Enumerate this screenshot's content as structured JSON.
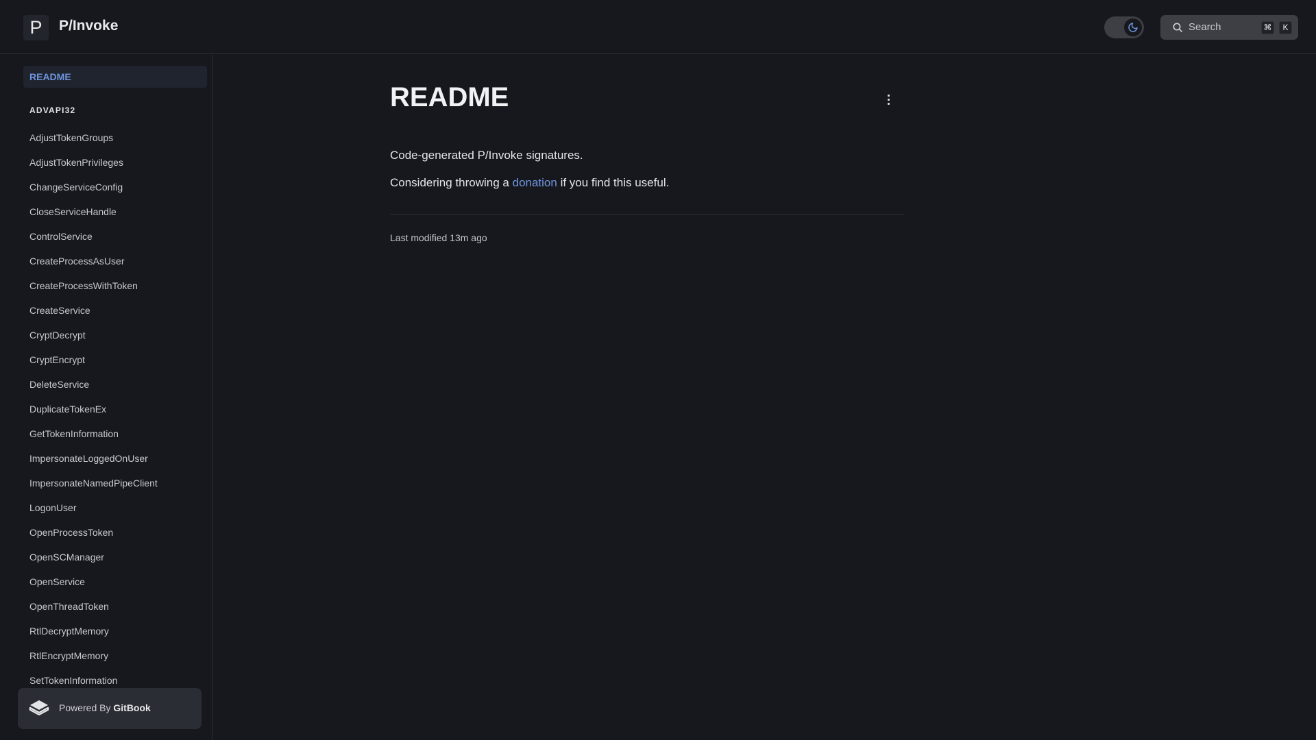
{
  "header": {
    "logo_letter": "P",
    "site_title": "P/Invoke",
    "theme_toggle_icon": "moon-icon",
    "search": {
      "label": "Search",
      "shortcut_keys": [
        "⌘",
        "K"
      ]
    }
  },
  "sidebar": {
    "active_item": "README",
    "section_title": "ADVAPI32",
    "items": [
      "AdjustTokenGroups",
      "AdjustTokenPrivileges",
      "ChangeServiceConfig",
      "CloseServiceHandle",
      "ControlService",
      "CreateProcessAsUser",
      "CreateProcessWithToken",
      "CreateService",
      "CryptDecrypt",
      "CryptEncrypt",
      "DeleteService",
      "DuplicateTokenEx",
      "GetTokenInformation",
      "ImpersonateLoggedOnUser",
      "ImpersonateNamedPipeClient",
      "LogonUser",
      "OpenProcessToken",
      "OpenSCManager",
      "OpenService",
      "OpenThreadToken",
      "RtlDecryptMemory",
      "RtlEncryptMemory",
      "SetTokenInformation"
    ],
    "powered_by": {
      "prefix": "Powered By",
      "brand": "GitBook"
    }
  },
  "main": {
    "title": "README",
    "paragraph1": "Code-generated P/Invoke signatures.",
    "paragraph2": {
      "before": "Considering throwing a ",
      "link": "donation",
      "after": " if you find this useful."
    },
    "last_modified": "Last modified 13m ago"
  },
  "colors": {
    "background": "#16181d",
    "accent": "#6f95e0",
    "active_bg": "#20242e"
  }
}
